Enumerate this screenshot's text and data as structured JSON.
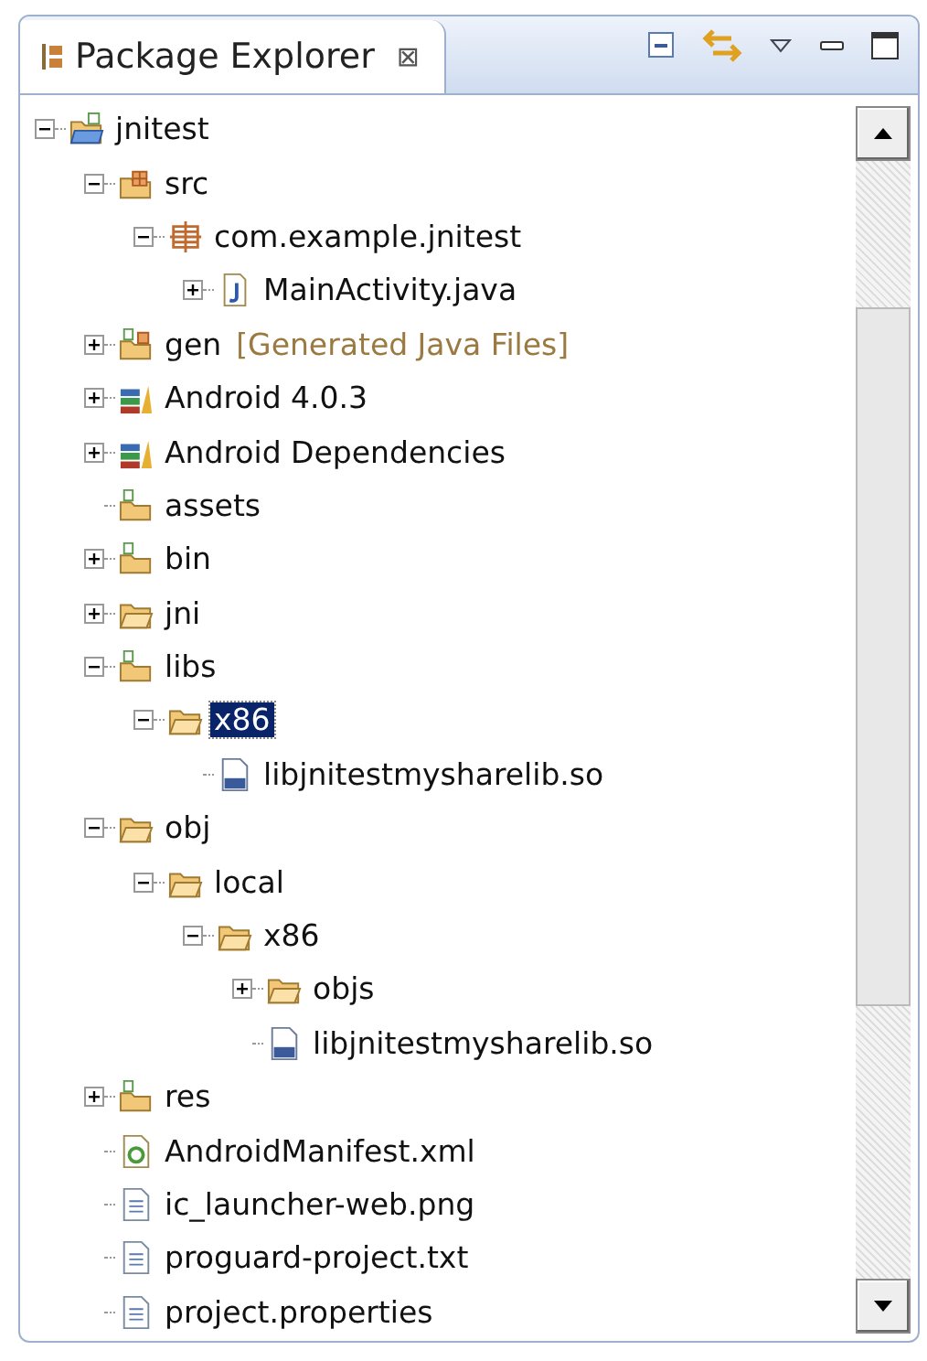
{
  "view": {
    "title": "Package Explorer",
    "close": "⊠"
  },
  "tree": [
    {
      "label": "jnitest",
      "kind": "project",
      "expanded": true,
      "selected": false,
      "children": [
        {
          "label": "src",
          "kind": "src-folder",
          "expanded": true,
          "selected": false,
          "children": [
            {
              "label": "com.example.jnitest",
              "kind": "package",
              "expanded": true,
              "selected": false,
              "children": [
                {
                  "label": "MainActivity.java",
                  "kind": "java-file",
                  "expanded": false,
                  "selected": false
                }
              ]
            }
          ]
        },
        {
          "label": "gen",
          "note": "[Generated Java Files]",
          "kind": "gen-folder",
          "expanded": false,
          "selected": false
        },
        {
          "label": "Android 4.0.3",
          "kind": "library",
          "expanded": false,
          "selected": false
        },
        {
          "label": "Android Dependencies",
          "kind": "library",
          "expanded": false,
          "selected": false
        },
        {
          "label": "assets",
          "kind": "res-folder",
          "selected": false
        },
        {
          "label": "bin",
          "kind": "res-folder",
          "expanded": false,
          "selected": false
        },
        {
          "label": "jni",
          "kind": "folder",
          "expanded": false,
          "selected": false
        },
        {
          "label": "libs",
          "kind": "res-folder",
          "expanded": true,
          "selected": false,
          "children": [
            {
              "label": "x86",
              "kind": "folder",
              "expanded": true,
              "selected": true,
              "children": [
                {
                  "label": "libjnitestmysharelib.so",
                  "kind": "binary-file",
                  "selected": false
                }
              ]
            }
          ]
        },
        {
          "label": "obj",
          "kind": "folder",
          "expanded": true,
          "selected": false,
          "children": [
            {
              "label": "local",
              "kind": "folder",
              "expanded": true,
              "selected": false,
              "children": [
                {
                  "label": "x86",
                  "kind": "folder",
                  "expanded": true,
                  "selected": false,
                  "children": [
                    {
                      "label": "objs",
                      "kind": "folder",
                      "expanded": false,
                      "selected": false
                    },
                    {
                      "label": "libjnitestmysharelib.so",
                      "kind": "binary-file",
                      "selected": false
                    }
                  ]
                }
              ]
            }
          ]
        },
        {
          "label": "res",
          "kind": "res-folder",
          "expanded": false,
          "selected": false
        },
        {
          "label": "AndroidManifest.xml",
          "kind": "manifest",
          "selected": false
        },
        {
          "label": "ic_launcher-web.png",
          "kind": "text-file",
          "selected": false
        },
        {
          "label": "proguard-project.txt",
          "kind": "text-file",
          "selected": false
        },
        {
          "label": "project.properties",
          "kind": "text-file",
          "selected": false
        }
      ]
    }
  ]
}
